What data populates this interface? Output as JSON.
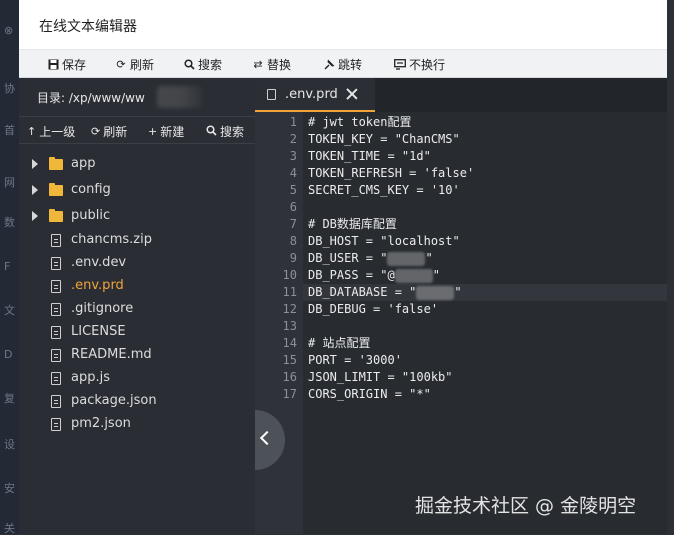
{
  "background_app": {
    "glyphs": [
      "⊗",
      "协",
      "首",
      "网",
      "数",
      "F",
      "文",
      "D",
      "复",
      "设",
      "安",
      "关"
    ]
  },
  "dialog": {
    "title": "在线文本编辑器",
    "toolbar": [
      {
        "label": "保存",
        "icon": "save-icon"
      },
      {
        "label": "刷新",
        "icon": "refresh-icon"
      },
      {
        "label": "搜索",
        "icon": "search-icon"
      },
      {
        "label": "替换",
        "icon": "replace-icon"
      },
      {
        "label": "跳转",
        "icon": "pin-icon"
      },
      {
        "label": "不换行",
        "icon": "wrap-icon"
      }
    ]
  },
  "sidebar": {
    "dir_label": "目录: /xp/www/ww",
    "ops": [
      {
        "label": "上一级",
        "icon": "arrow-up-icon"
      },
      {
        "label": "刷新",
        "icon": "refresh-icon"
      },
      {
        "label": "新建",
        "icon": "plus-icon"
      },
      {
        "label": "搜索",
        "icon": "search-icon"
      }
    ],
    "tree": [
      {
        "name": "app",
        "type": "folder"
      },
      {
        "name": "config",
        "type": "folder"
      },
      {
        "name": "public",
        "type": "folder"
      },
      {
        "name": "chancms.zip",
        "type": "file"
      },
      {
        "name": ".env.dev",
        "type": "file"
      },
      {
        "name": ".env.prd",
        "type": "file",
        "active": true
      },
      {
        "name": ".gitignore",
        "type": "file"
      },
      {
        "name": "LICENSE",
        "type": "file"
      },
      {
        "name": "README.md",
        "type": "file"
      },
      {
        "name": "app.js",
        "type": "file"
      },
      {
        "name": "package.json",
        "type": "file"
      },
      {
        "name": "pm2.json",
        "type": "file"
      }
    ]
  },
  "editor": {
    "tab": {
      "label": ".env.prd"
    },
    "current_line": 11,
    "lines": [
      "# jwt token配置",
      "TOKEN_KEY = \"ChanCMS\"",
      "TOKEN_TIME = \"1d\"",
      "TOKEN_REFRESH = 'false'",
      "SECRET_CMS_KEY = '10'",
      "",
      "# DB数据库配置",
      "DB_HOST = \"localhost\"",
      "DB_USER = \"",
      "DB_PASS = \"@",
      "DB_DATABASE = \"",
      "DB_DEBUG = 'false'",
      "",
      "# 站点配置",
      "PORT = '3000'",
      "JSON_LIMIT = \"100kb\"",
      "CORS_ORIGIN = \"*\""
    ],
    "masked_lines": [
      9,
      10,
      11
    ]
  },
  "watermark": "掘金技术社区 @ 金陵明空",
  "colors": {
    "accent": "#f0a33a",
    "folder": "#f0b73a",
    "sidebar_bg": "#2a2e34",
    "editor_bg": "#282c31"
  }
}
